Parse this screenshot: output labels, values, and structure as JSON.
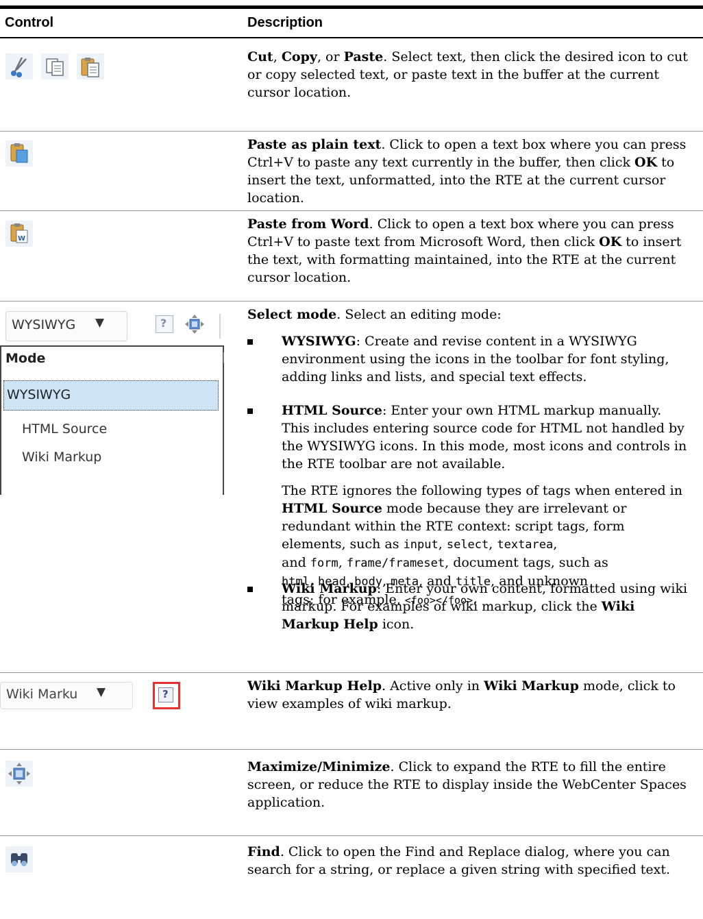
{
  "header": {
    "control": "Control",
    "description": "Description"
  },
  "rows": {
    "cut_copy_paste": {
      "t1": "Cut",
      "t2": ", ",
      "t3": "Copy",
      "t4": ", or ",
      "t5": "Paste",
      "t6": ".",
      "rest": " Select text, then click the desired icon to cut or copy selected text, or paste text in the buffer at the current cursor location.",
      "icons": [
        "cut-icon",
        "copy-icon",
        "paste-icon"
      ]
    },
    "paste_plain": {
      "title": "Paste as plain text",
      "a": ". Click to open a text box where you can press Ctrl+V to paste any text currently in the buffer, then click ",
      "ok": "OK",
      "b": " to insert the text, unformatted, into the RTE at the current cursor location.",
      "icon": "paste-plain-text-icon"
    },
    "paste_word": {
      "title": "Paste from Word",
      "a": ". Click to open a text box where you can press Ctrl+V to paste text from Microsoft Word, then click ",
      "ok": "OK",
      "b": " to insert the text, with formatting maintained, into the RTE at the current cursor location.",
      "icon": "paste-from-word-icon"
    },
    "select_mode": {
      "title": "Select mode",
      "intro": ". Select an editing mode:",
      "wysiwyg_label": "WYSIWYG",
      "wysiwyg_text": ": Create and revise content in a WYSIWYG environment using the icons in the toolbar for font styling, adding links and lists, and special text effects.",
      "html_label": "HTML Source",
      "html_text": ": Enter your own HTML markup manually. This includes entering source code for HTML not handled by the WYSIWYG icons. In this mode, most icons and controls in the RTE toolbar are not available.",
      "ignore_a": "The RTE ignores the following types of tags when entered in ",
      "ignore_b": "HTML Source",
      "ignore_c": " mode because they are irrelevant or redundant within the RTE context: script tags, form elements, such as ",
      "c_input": "input",
      "sep1": ", ",
      "c_select": "select",
      "sep2": ", ",
      "c_textarea": "textarea",
      "sep3": ",",
      "ignore_d": "and ",
      "c_form": "form",
      "sep4": ", ",
      "c_frame": "frame/frameset",
      "ignore_e": ", document tags, such as",
      "c_html": "html",
      "sep5": ", ",
      "c_head": "head",
      "sep6": ", ",
      "c_body": "body",
      "sep7": ", ",
      "c_meta": "meta",
      "ignore_f": ", and ",
      "c_title": "title",
      "ignore_g": ", and unknown",
      "ignore_h": "tags; for example, ",
      "c_foo": "<foo></foo>",
      "ignore_i": ".",
      "wiki_label": "Wiki Markup",
      "wiki_text": ": Enter your own content, formatted using wiki markup. For examples of wiki markup, click the ",
      "wiki_help": "Wiki Markup Help",
      "wiki_end": " icon.",
      "dropdown": {
        "selected": "WYSIWYG",
        "heading": "Mode",
        "options": [
          "WYSIWYG",
          "HTML Source",
          "Wiki Markup"
        ]
      }
    },
    "wiki_help": {
      "title": "Wiki Markup Help",
      "a": ". Active only in ",
      "mode": "Wiki Markup",
      "b": " mode, click to view examples of wiki markup.",
      "selected": "Wiki Marku"
    },
    "maximize": {
      "title": "Maximize/Minimize",
      "a": ". Click to expand the RTE to fill the entire screen, or reduce the RTE to display inside the WebCenter Spaces application.",
      "icon": "maximize-icon"
    },
    "find": {
      "title": "Find",
      "a": ". Click to open the Find and Replace dialog, where you can search for a string, or replace a given string with specified text.",
      "icon": "find-icon"
    }
  },
  "colors": {
    "selection": "#cde4f7",
    "highlight_box": "#e53030",
    "icon_blue": "#3a78c8"
  }
}
